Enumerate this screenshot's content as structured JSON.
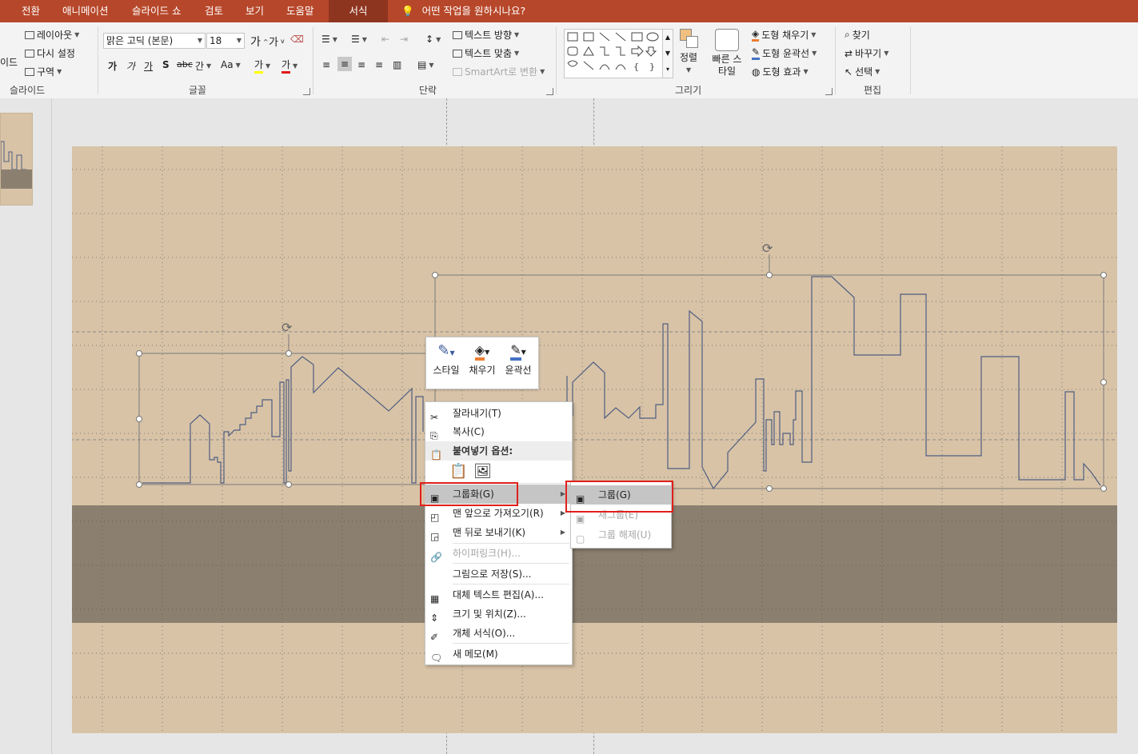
{
  "tabs": [
    "전환",
    "애니메이션",
    "슬라이드 쇼",
    "검토",
    "보기",
    "도움말",
    "서식"
  ],
  "tell_me": "어떤 작업을 원하시나요?",
  "ribbon": {
    "slides": {
      "partial_label": "이드",
      "layout": "레이아웃",
      "reset": "다시 설정",
      "section": "구역",
      "group": "슬라이드"
    },
    "font": {
      "name": "맑은 고딕 (본문)",
      "size": "18",
      "group": "글꼴",
      "bold": "가",
      "italic": "가",
      "underline": "가",
      "shadow": "S",
      "strike": "abc",
      "spacing": "간",
      "case": "Aa"
    },
    "paragraph": {
      "text_direction": "텍스트 방향",
      "align_text": "텍스트 맞춤",
      "smartart": "SmartArt로 변환",
      "group": "단락"
    },
    "drawing": {
      "arrange": "정렬",
      "quick_styles": "빠른 스타일",
      "shape_fill": "도형 채우기",
      "shape_outline": "도형 윤곽선",
      "shape_effects": "도형 효과",
      "group": "그리기"
    },
    "editing": {
      "find": "찾기",
      "replace": "바꾸기",
      "select": "선택",
      "group": "편집"
    }
  },
  "mini_toolbar": {
    "style": "스타일",
    "fill": "채우기",
    "outline": "윤곽선"
  },
  "context_menu": {
    "cut": "잘라내기(T)",
    "copy": "복사(C)",
    "paste_options": "붙여넣기 옵션:",
    "group": "그룹화(G)",
    "bring_front": "맨 앞으로 가져오기(R)",
    "send_back": "맨 뒤로 보내기(K)",
    "hyperlink": "하이퍼링크(H)...",
    "save_picture": "그림으로 저장(S)...",
    "alt_text": "대체 텍스트 편집(A)...",
    "size_position": "크기 및 위치(Z)...",
    "format_object": "개체 서식(O)...",
    "new_comment": "새 메모(M)"
  },
  "submenu": {
    "group": "그룹(G)",
    "regroup": "재그룹(E)",
    "ungroup": "그룹 해제(U)"
  },
  "colors": {
    "accent": "#b7472a",
    "slide_bg": "#d8c3a7",
    "band": "#8b8070",
    "line": "#4f5e80",
    "highlight_box": "#e0201a"
  }
}
